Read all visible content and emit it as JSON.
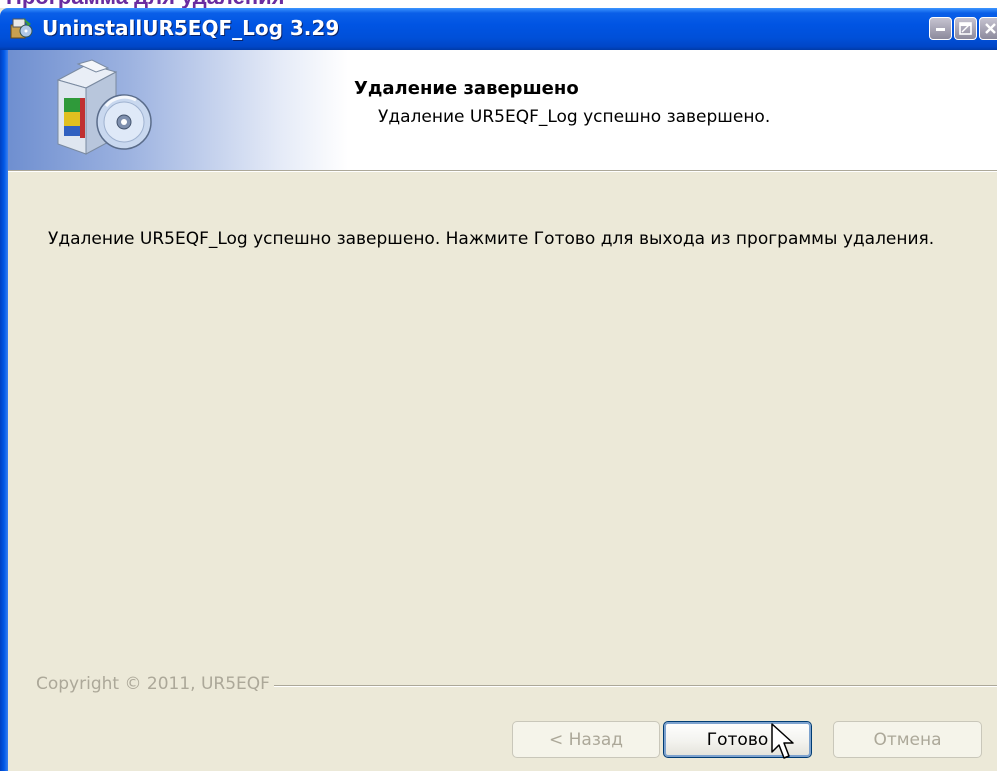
{
  "page": {
    "cropped_text": "Программа для удаления"
  },
  "window": {
    "title": "UninstallUR5EQF_Log 3.29",
    "icons": {
      "app": "setup-app-icon",
      "minimize": "minimize-icon",
      "maximize": "maximize-icon",
      "close": "close-icon"
    },
    "colors": {
      "titlebar": "#0054e3",
      "body": "#ece9d8"
    }
  },
  "header": {
    "title": "Удаление завершено",
    "subtitle": "Удаление UR5EQF_Log успешно завершено.",
    "icon": "software-box-cd-icon"
  },
  "body": {
    "message": "Удаление UR5EQF_Log успешно завершено. Нажмите Готово для выхода из программы удаления."
  },
  "footer": {
    "copyright": "Copyright © 2011, UR5EQF"
  },
  "buttons": {
    "back": "< Назад",
    "finish": "Готово",
    "cancel": "Отмена"
  }
}
